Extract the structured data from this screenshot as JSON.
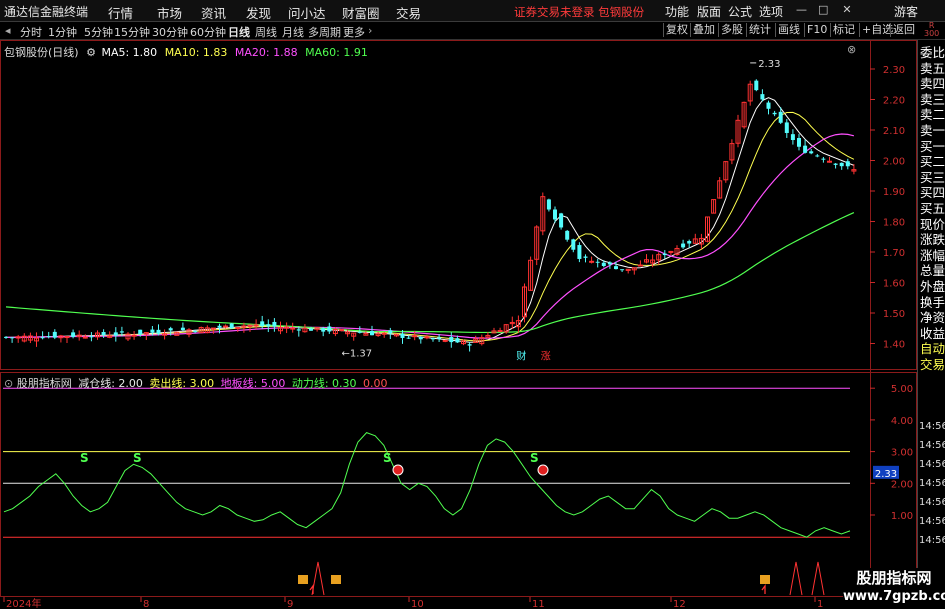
{
  "app": {
    "title": "通达信金融终端",
    "menu": [
      "行情",
      "市场",
      "资讯",
      "发现",
      "问小达",
      "财富圈",
      "交易"
    ],
    "warning": "证券交易未登录  包钢股份",
    "right_menu": [
      "功能",
      "版面",
      "公式",
      "选项"
    ],
    "guest": "游客"
  },
  "periods": {
    "items": [
      "分时",
      "1分钟",
      "5分钟",
      "15分钟",
      "30分钟",
      "60分钟",
      "日线",
      "周线",
      "月线",
      "多周期",
      "更多"
    ],
    "active": "日线"
  },
  "tools": [
    "复权",
    "叠加",
    "多股",
    "统计",
    "画线",
    "F10",
    "标记",
    "+自选",
    "返回"
  ],
  "main_legend": {
    "stock": "包钢股份(日线)",
    "ma": [
      {
        "label": "MA5: 1.80",
        "color": "#ffffff"
      },
      {
        "label": "MA10: 1.83",
        "color": "#ffff50"
      },
      {
        "label": "MA20: 1.88",
        "color": "#ff50ff"
      },
      {
        "label": "MA60: 1.91",
        "color": "#50ff50"
      }
    ]
  },
  "price_axis": [
    "2.30",
    "2.20",
    "2.10",
    "2.00",
    "1.90",
    "1.80",
    "1.70",
    "1.60",
    "1.50",
    "1.40"
  ],
  "high_label": "2.33",
  "low_label": "1.37",
  "markers": {
    "cai": "财",
    "zhang": "涨"
  },
  "indicator": {
    "name": "股朋指标网",
    "lines": [
      {
        "label": "减仓线: 2.00",
        "color": "#e8e8e8"
      },
      {
        "label": "卖出线: 3.00",
        "color": "#ffff50"
      },
      {
        "label": "地板线: 5.00",
        "color": "#ff50ff"
      },
      {
        "label": "动力线: 0.30",
        "color": "#50ff50"
      },
      {
        "label": "0.00",
        "color": "#ff5050"
      }
    ],
    "axis": [
      "5.00",
      "4.00",
      "3.00",
      "2.00",
      "1.00"
    ],
    "current": "2.33",
    "s_mark": "S"
  },
  "date_axis": [
    "2024年",
    "8",
    "9",
    "10",
    "11",
    "12",
    "1"
  ],
  "side_panel": [
    "委比",
    "卖五",
    "卖四",
    "卖三",
    "卖二",
    "卖一",
    "买一",
    "买二",
    "买三",
    "买四",
    "买五",
    "现价",
    "涨跌",
    "涨幅",
    "总量",
    "外盘",
    "换手",
    "净资",
    "收益",
    "自动",
    "交易"
  ],
  "side_times": [
    "14:56",
    "14:56",
    "14:56",
    "14:56",
    "14:56",
    "14:56",
    "14:56"
  ],
  "side_top": {
    "r": "R",
    "num": "300"
  },
  "watermark": {
    "line1": "股朋指标网",
    "line2": "www.7gpzb.com"
  },
  "colors": {
    "up": "#ff3232",
    "down": "#54fcfc",
    "ma5": "#ffffff",
    "ma10": "#ffff50",
    "ma20": "#ff50ff",
    "ma60": "#50ff50",
    "axis": "#c82828"
  }
}
